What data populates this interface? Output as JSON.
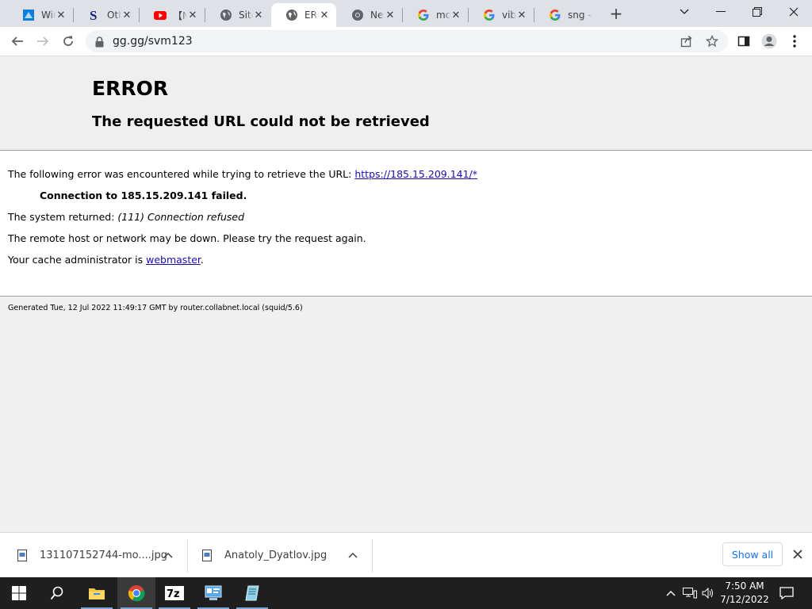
{
  "tabs": [
    {
      "title": "Windows",
      "icon": "windows-logo-icon"
    },
    {
      "title": "Other",
      "icon": "s-logo-icon"
    },
    {
      "title": "【Ne",
      "icon": "youtube-icon"
    },
    {
      "title": "Site",
      "icon": "globe-icon"
    },
    {
      "title": "ERROR",
      "icon": "globe-icon",
      "active": true
    },
    {
      "title": "New",
      "icon": "chrome-icon"
    },
    {
      "title": "mo",
      "icon": "google-icon"
    },
    {
      "title": "vibe",
      "icon": "google-icon"
    },
    {
      "title": "sng - Google",
      "icon": "google-icon"
    }
  ],
  "window_controls": {
    "tab_search": "⌄",
    "minimize": "─",
    "restore": "❐",
    "close": "✕"
  },
  "address_bar": {
    "url": "gg.gg/svm123"
  },
  "page": {
    "title": "ERROR",
    "subtitle": "The requested URL could not be retrieved",
    "line1_prefix": "The following error was encountered while trying to retrieve the URL: ",
    "line1_link": "https://185.15.209.141/*",
    "line2": "Connection to 185.15.209.141 failed.",
    "line3_prefix": "The system returned: ",
    "line3_italic": "(111) Connection refused",
    "line4": "The remote host or network may be down. Please try the request again.",
    "line5_prefix": "Your cache administrator is ",
    "line5_link": "webmaster",
    "line5_suffix": ".",
    "footer": "Generated Tue, 12 Jul 2022 11:49:17 GMT by router.collabnet.local (squid/5.6)"
  },
  "downloads": {
    "items": [
      {
        "name": "131107152744-mo....jpg"
      },
      {
        "name": "Anatoly_Dyatlov.jpg"
      }
    ],
    "show_all": "Show all"
  },
  "taskbar": {
    "apps": [
      "start-icon",
      "search-icon",
      "file-explorer-icon",
      "chrome-icon",
      "7zip-icon",
      "control-panel-icon",
      "notepad-icon"
    ],
    "clock_time": "7:50 AM",
    "clock_date": "7/12/2022"
  },
  "colors": {
    "link": "#1a0dab",
    "show_all": "#1a73e8",
    "taskbar": "#1f1f1f"
  }
}
